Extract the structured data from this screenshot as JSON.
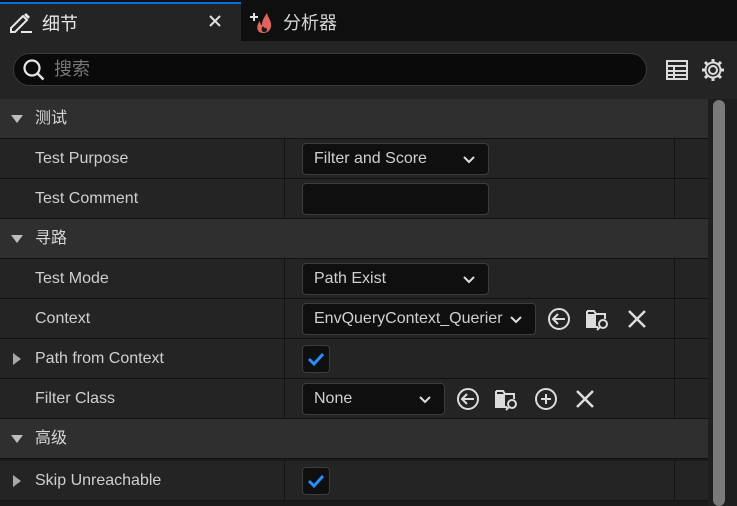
{
  "tabs": [
    {
      "label": "细节",
      "icon": "details-pencil-icon",
      "active": true
    },
    {
      "label": "分析器",
      "icon": "profiler-flame-icon",
      "active": false
    }
  ],
  "search": {
    "placeholder": "搜索"
  },
  "toolbar": {
    "table_icon": "table-view-icon",
    "settings_icon": "gear-icon"
  },
  "sections": [
    {
      "label": "测试"
    },
    {
      "label": "寻路"
    },
    {
      "label": "高级"
    }
  ],
  "properties": {
    "test_purpose": {
      "label": "Test Purpose",
      "value": "Filter and Score"
    },
    "test_comment": {
      "label": "Test Comment",
      "value": ""
    },
    "test_mode": {
      "label": "Test Mode",
      "value": "Path Exist"
    },
    "context": {
      "label": "Context",
      "value": "EnvQueryContext_Querier"
    },
    "path_from_context": {
      "label": "Path from Context",
      "checked": true
    },
    "filter_class": {
      "label": "Filter Class",
      "value": "None"
    },
    "skip_unreachable": {
      "label": "Skip Unreachable",
      "checked": true
    }
  },
  "colors": {
    "accent": "#0070e0",
    "checkmark": "#2a8cff",
    "flame": "#e0635e"
  }
}
